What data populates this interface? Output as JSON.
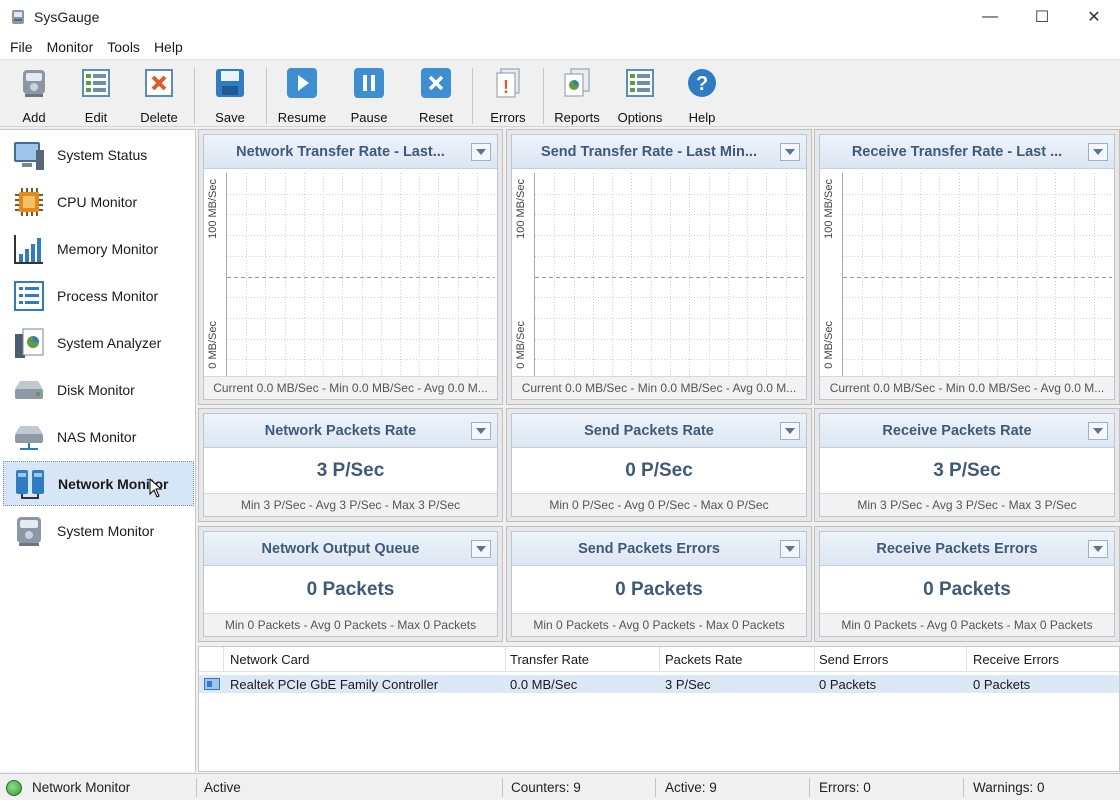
{
  "window": {
    "title": "SysGauge",
    "minimize": "—",
    "maximize": "☐",
    "close": "✕"
  },
  "menu": [
    "File",
    "Monitor",
    "Tools",
    "Help"
  ],
  "toolbar": {
    "add": "Add",
    "edit": "Edit",
    "delete": "Delete",
    "save": "Save",
    "resume": "Resume",
    "pause": "Pause",
    "reset": "Reset",
    "errors": "Errors",
    "reports": "Reports",
    "options": "Options",
    "help": "Help"
  },
  "sidebar": {
    "items": [
      {
        "label": "System Status",
        "icon": "system-status-icon"
      },
      {
        "label": "CPU Monitor",
        "icon": "cpu-icon"
      },
      {
        "label": "Memory Monitor",
        "icon": "memory-chart-icon"
      },
      {
        "label": "Process Monitor",
        "icon": "process-list-icon"
      },
      {
        "label": "System Analyzer",
        "icon": "system-analyzer-icon"
      },
      {
        "label": "Disk Monitor",
        "icon": "disk-icon"
      },
      {
        "label": "NAS Monitor",
        "icon": "nas-icon"
      },
      {
        "label": "Network Monitor",
        "icon": "network-icon"
      },
      {
        "label": "System Monitor",
        "icon": "system-monitor-icon"
      }
    ],
    "selected": "Network Monitor"
  },
  "charts": [
    {
      "title": "Network Transfer Rate - Last...",
      "y_top": "100 MB/Sec",
      "y_bottom": "0 MB/Sec",
      "footer": "Current 0.0 MB/Sec - Min 0.0 MB/Sec - Avg 0.0 M..."
    },
    {
      "title": "Send Transfer Rate - Last Min...",
      "y_top": "100 MB/Sec",
      "y_bottom": "0 MB/Sec",
      "footer": "Current 0.0 MB/Sec - Min 0.0 MB/Sec - Avg 0.0 M..."
    },
    {
      "title": "Receive Transfer Rate - Last ...",
      "y_top": "100 MB/Sec",
      "y_bottom": "0 MB/Sec",
      "footer": "Current 0.0 MB/Sec - Min 0.0 MB/Sec - Avg 0.0 M..."
    }
  ],
  "counters_row1": [
    {
      "title": "Network Packets Rate",
      "value": "3 P/Sec",
      "footer": "Min 3 P/Sec - Avg 3 P/Sec - Max 3 P/Sec"
    },
    {
      "title": "Send Packets Rate",
      "value": "0 P/Sec",
      "footer": "Min 0 P/Sec - Avg 0 P/Sec - Max 0 P/Sec"
    },
    {
      "title": "Receive Packets Rate",
      "value": "3 P/Sec",
      "footer": "Min 3 P/Sec - Avg 3 P/Sec - Max 3 P/Sec"
    }
  ],
  "counters_row2": [
    {
      "title": "Network Output Queue",
      "value": "0 Packets",
      "footer": "Min 0 Packets - Avg 0 Packets - Max 0 Packets"
    },
    {
      "title": "Send Packets Errors",
      "value": "0 Packets",
      "footer": "Min 0 Packets - Avg 0 Packets - Max 0 Packets"
    },
    {
      "title": "Receive Packets Errors",
      "value": "0 Packets",
      "footer": "Min 0 Packets - Avg 0 Packets - Max 0 Packets"
    }
  ],
  "table": {
    "headers": [
      "Network Card",
      "Transfer Rate",
      "Packets Rate",
      "Send Errors",
      "Receive Errors"
    ],
    "rows": [
      [
        "Realtek PCIe GbE Family Controller",
        "0.0 MB/Sec",
        "3 P/Sec",
        "0 Packets",
        "0 Packets"
      ]
    ]
  },
  "statusbar": {
    "monitor": "Network Monitor",
    "state": "Active",
    "counters": "Counters: 9",
    "active": "Active: 9",
    "errors": "Errors: 0",
    "warnings": "Warnings: 0"
  },
  "colors": {
    "accent": "#3f5a78",
    "selected_bg": "#d7e6f7",
    "status_ok": "#2e9a2e"
  }
}
